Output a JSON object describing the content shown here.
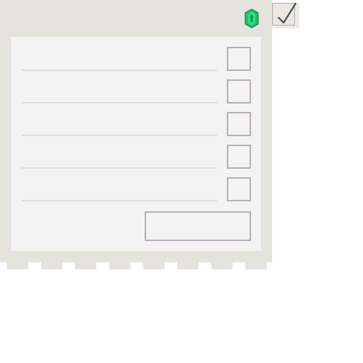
{
  "window": {
    "title": "",
    "status_icon": "green-gem-icon",
    "check_icon": "checkmark-icon"
  },
  "form": {
    "rows": [
      {
        "value": "",
        "checked": false
      },
      {
        "value": "",
        "checked": false
      },
      {
        "value": "",
        "checked": false
      },
      {
        "value": "",
        "checked": false
      },
      {
        "value": "",
        "checked": false
      }
    ],
    "submit_label": ""
  },
  "colors": {
    "panel": "#e4e4dc",
    "content": "#f3f3f3",
    "border": "#b7adb3",
    "underline": "#dfdfd5",
    "gem": "#19c36a"
  }
}
